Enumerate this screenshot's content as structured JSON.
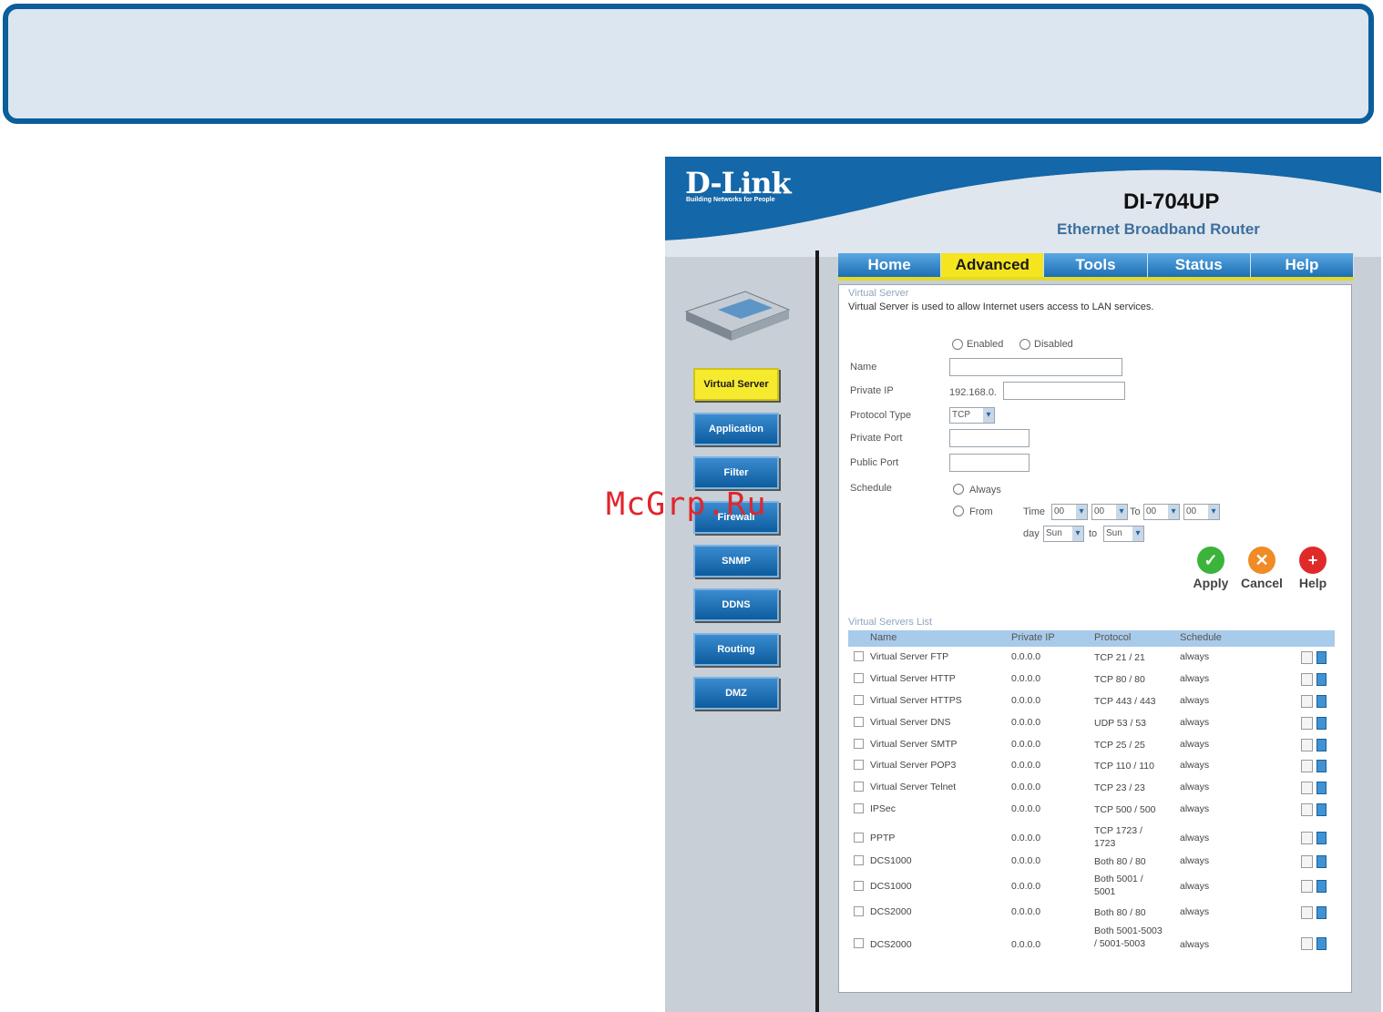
{
  "header": {
    "logo": "D-Link",
    "logo_tagline": "Building Networks for People",
    "model": "DI-704UP",
    "model_subtitle": "Ethernet Broadband Router"
  },
  "sidebar": {
    "items": [
      {
        "label": "Virtual Server",
        "active": true
      },
      {
        "label": "Application",
        "active": false
      },
      {
        "label": "Filter",
        "active": false
      },
      {
        "label": "Firewall",
        "active": false
      },
      {
        "label": "SNMP",
        "active": false
      },
      {
        "label": "DDNS",
        "active": false
      },
      {
        "label": "Routing",
        "active": false
      },
      {
        "label": "DMZ",
        "active": false
      }
    ]
  },
  "tabs": [
    {
      "label": "Home",
      "active": false
    },
    {
      "label": "Advanced",
      "active": true
    },
    {
      "label": "Tools",
      "active": false
    },
    {
      "label": "Status",
      "active": false
    },
    {
      "label": "Help",
      "active": false
    }
  ],
  "form": {
    "section_title": "Virtual Server",
    "description": "Virtual Server is used to allow Internet users access to LAN services.",
    "enabled_label": "Enabled",
    "disabled_label": "Disabled",
    "name_label": "Name",
    "name_value": "",
    "private_ip_label": "Private IP",
    "private_ip_prefix": "192.168.0.",
    "private_ip_value": "",
    "protocol_label": "Protocol Type",
    "protocol_value": "TCP",
    "private_port_label": "Private Port",
    "private_port_value": "",
    "public_port_label": "Public Port",
    "public_port_value": "",
    "schedule_label": "Schedule",
    "always_label": "Always",
    "from_label": "From",
    "time_label": "Time",
    "time_from_hour": "00",
    "time_from_min": "00",
    "to_label": "To",
    "time_to_hour": "00",
    "time_to_min": "00",
    "day_label": "day",
    "day_from": "Sun",
    "day_to_label": "to",
    "day_to": "Sun"
  },
  "actions": {
    "apply": "Apply",
    "cancel": "Cancel",
    "help": "Help"
  },
  "list": {
    "title": "Virtual Servers List",
    "columns": [
      "Name",
      "Private IP",
      "Protocol",
      "Schedule"
    ],
    "rows": [
      {
        "name": "Virtual Server FTP",
        "ip": "0.0.0.0",
        "protocol": "TCP 21 / 21",
        "schedule": "always"
      },
      {
        "name": "Virtual Server HTTP",
        "ip": "0.0.0.0",
        "protocol": "TCP 80 / 80",
        "schedule": "always"
      },
      {
        "name": "Virtual Server HTTPS",
        "ip": "0.0.0.0",
        "protocol": "TCP 443 / 443",
        "schedule": "always"
      },
      {
        "name": "Virtual Server DNS",
        "ip": "0.0.0.0",
        "protocol": "UDP 53 / 53",
        "schedule": "always"
      },
      {
        "name": "Virtual Server SMTP",
        "ip": "0.0.0.0",
        "protocol": "TCP 25 / 25",
        "schedule": "always"
      },
      {
        "name": "Virtual Server POP3",
        "ip": "0.0.0.0",
        "protocol": "TCP 110 / 110",
        "schedule": "always"
      },
      {
        "name": "Virtual Server Telnet",
        "ip": "0.0.0.0",
        "protocol": "TCP 23 / 23",
        "schedule": "always"
      },
      {
        "name": "IPSec",
        "ip": "0.0.0.0",
        "protocol": "TCP 500 / 500",
        "schedule": "always"
      },
      {
        "name": "PPTP",
        "ip": "0.0.0.0",
        "protocol": "TCP 1723 / 1723",
        "schedule": "always"
      },
      {
        "name": "DCS1000",
        "ip": "0.0.0.0",
        "protocol": "Both 80 / 80",
        "schedule": "always"
      },
      {
        "name": "DCS1000",
        "ip": "0.0.0.0",
        "protocol": "Both 5001 / 5001",
        "schedule": "always"
      },
      {
        "name": "DCS2000",
        "ip": "0.0.0.0",
        "protocol": "Both 80 / 80",
        "schedule": "always"
      },
      {
        "name": "DCS2000",
        "ip": "0.0.0.0",
        "protocol": "Both 5001-5003 / 5001-5003",
        "schedule": "always"
      }
    ]
  },
  "watermark": "McGrp.Ru",
  "colors": {
    "brand_blue": "#0b5e9a",
    "active_yellow": "#f5e51e",
    "tab_blue": "#1c6fb4"
  }
}
